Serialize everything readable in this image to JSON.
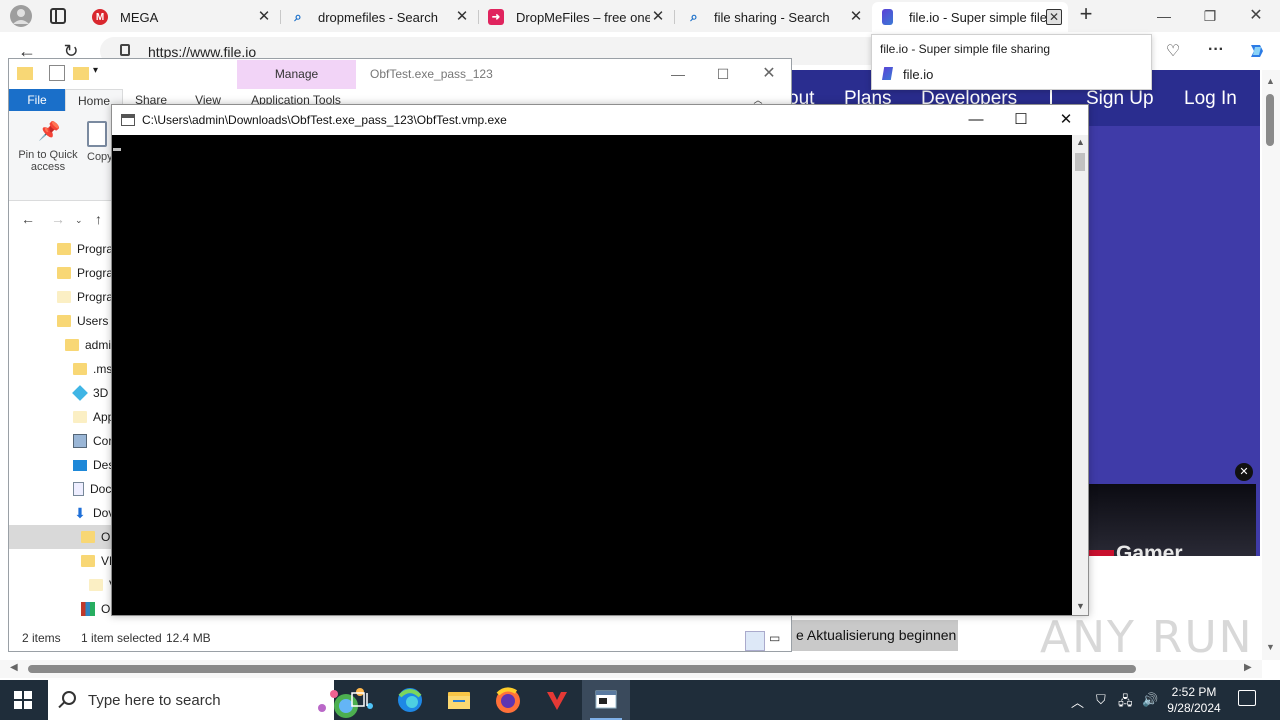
{
  "browser": {
    "tabs": [
      {
        "title": "MEGA",
        "icon": "mega-icon",
        "color": "#d9272e"
      },
      {
        "title": "dropmefiles - Search",
        "icon": "search-icon",
        "color": "#1a6fc9"
      },
      {
        "title": "DropMeFiles – free one-c",
        "icon": "dropmefiles-icon",
        "color": "#e0245e"
      },
      {
        "title": "file sharing - Search",
        "icon": "search-icon",
        "color": "#1a6fc9"
      },
      {
        "title": "file.io - Super simple file",
        "icon": "fileio-icon",
        "color": "#5b3fd6"
      }
    ],
    "address": "https://www.file.io",
    "tooltip": {
      "title": "file.io - Super simple file sharing",
      "site": "file.io"
    }
  },
  "webpage": {
    "nav": {
      "about": "out",
      "plans": "Plans",
      "developers": "Developers",
      "signup": "Sign Up",
      "login": "Log In"
    },
    "promo_title": "Gamer",
    "update_button": "e Aktualisierung beginnen",
    "watermark": "ANY RUN"
  },
  "explorer": {
    "manage_tab": "Manage",
    "window_caption": "ObfTest.exe_pass_123",
    "ribbon_tabs": {
      "file": "File",
      "home": "Home",
      "share": "Share",
      "view": "View",
      "app_tools": "Application Tools"
    },
    "ribbon": {
      "pin": "Pin to Quick access",
      "copy": "Copy"
    },
    "tree": [
      {
        "label": "Progra",
        "type": "folder"
      },
      {
        "label": "Progra",
        "type": "folder"
      },
      {
        "label": "Progra",
        "type": "folder-pale"
      },
      {
        "label": "Users",
        "type": "folder"
      },
      {
        "label": "admi",
        "type": "folder"
      },
      {
        "label": ".ms",
        "type": "folder"
      },
      {
        "label": "3D",
        "type": "3d"
      },
      {
        "label": "App",
        "type": "folder-pale"
      },
      {
        "label": "Cor",
        "type": "contacts"
      },
      {
        "label": "Des",
        "type": "desktop"
      },
      {
        "label": "Doc",
        "type": "documents"
      },
      {
        "label": "Dov",
        "type": "downloads"
      },
      {
        "label": "O",
        "type": "folder",
        "selected": true
      },
      {
        "label": "VM",
        "type": "folder"
      },
      {
        "label": "V",
        "type": "folder-pale"
      },
      {
        "label": "O",
        "type": "archive"
      }
    ],
    "status": {
      "items": "2 items",
      "selected": "1 item selected",
      "size": "12.4 MB"
    }
  },
  "console": {
    "title": "C:\\Users\\admin\\Downloads\\ObfTest.exe_pass_123\\ObfTest.vmp.exe"
  },
  "taskbar": {
    "search_placeholder": "Type here to search",
    "time": "2:52 PM",
    "date": "9/28/2024"
  }
}
